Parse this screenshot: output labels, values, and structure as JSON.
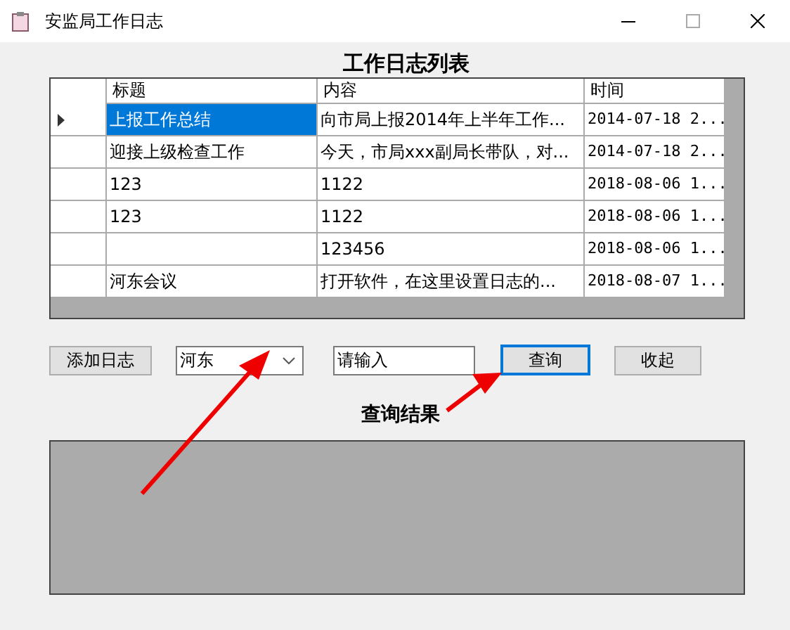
{
  "window": {
    "title": "安监局工作日志"
  },
  "list_heading": "工作日志列表",
  "table": {
    "columns": [
      "标题",
      "内容",
      "时间"
    ],
    "rows": [
      {
        "cells": [
          "上报工作总结",
          "向市局上报2014年上半年工作...",
          "2014-07-18 2..."
        ],
        "selected": true
      },
      {
        "cells": [
          "迎接上级检查工作",
          "今天，市局xxx副局长带队，对...",
          "2014-07-18 2..."
        ],
        "selected": false
      },
      {
        "cells": [
          "123",
          "1122",
          "2018-08-06 1..."
        ],
        "selected": false
      },
      {
        "cells": [
          "123",
          "1122",
          "2018-08-06 1..."
        ],
        "selected": false
      },
      {
        "cells": [
          "",
          "123456",
          "2018-08-06 1..."
        ],
        "selected": false
      },
      {
        "cells": [
          "河东会议",
          "打开软件，在这里设置日志的...",
          "2018-08-07 1..."
        ],
        "selected": false
      }
    ]
  },
  "toolbar": {
    "add_button": "添加日志",
    "dropdown_value": "河东",
    "search_value": "请输入",
    "query_button": {
      "label": "查询",
      "focused": true
    },
    "collapse_button": "收起"
  },
  "result_heading": "查询结果"
}
